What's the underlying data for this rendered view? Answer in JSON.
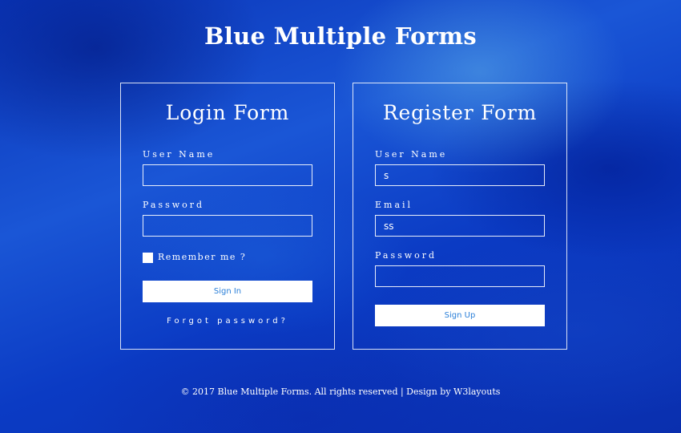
{
  "page": {
    "title": "Blue Multiple Forms"
  },
  "login": {
    "title": "Login Form",
    "username_label": "User Name",
    "username_value": "",
    "password_label": "Password",
    "password_value": "",
    "remember_label": "Remember me ?",
    "remember_checked": false,
    "signin_label": "Sign In",
    "forgot_label": "Forgot password?"
  },
  "register": {
    "title": "Register Form",
    "username_label": "User Name",
    "username_value": "s",
    "email_label": "Email",
    "email_value": "ss",
    "password_label": "Password",
    "password_value": "",
    "signup_label": "Sign Up"
  },
  "footer": {
    "copyright": "© 2017 Blue Multiple Forms. All rights reserved | Design by ",
    "link_text": "W3layouts"
  },
  "colors": {
    "background": "#1a56d6",
    "text": "#ffffff",
    "button_text": "#2a7fd8"
  }
}
